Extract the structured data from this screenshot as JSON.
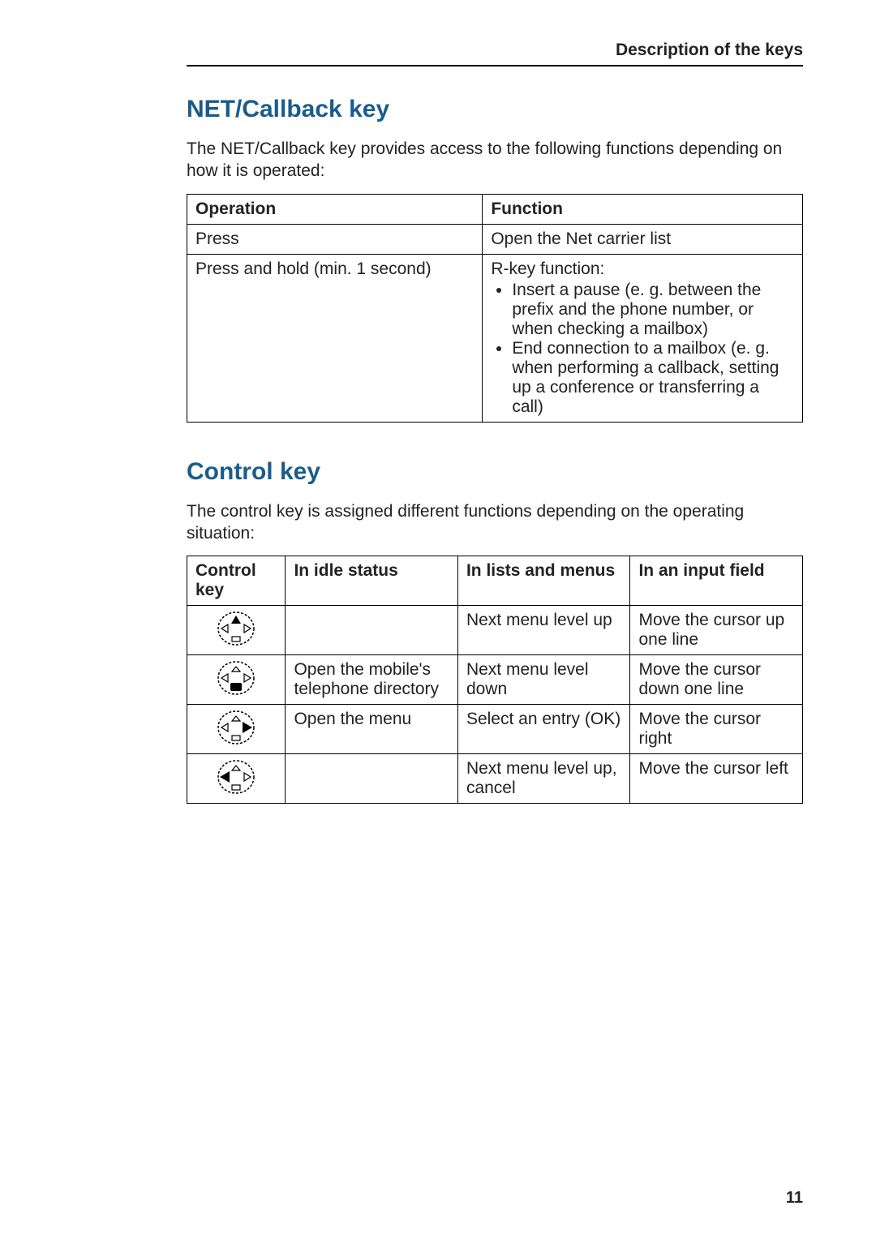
{
  "header": {
    "section": "Description of the keys"
  },
  "sections": {
    "net": {
      "heading": "NET/Callback key",
      "intro": "The NET/Callback key provides access to the following functions depending on how it is operated:",
      "table": {
        "headers": {
          "col1": "Operation",
          "col2": "Function"
        },
        "rows": [
          {
            "operation": "Press",
            "function_text": "Open the Net carrier list"
          },
          {
            "operation": "Press and hold (min. 1 second)",
            "function_text": "R-key function:",
            "bullets": [
              "Insert a pause (e. g. between the prefix and the phone number, or when checking a mailbox)",
              "End connection to a mailbox (e. g. when performing a callback, setting up a conference or transferring a call)"
            ]
          }
        ]
      }
    },
    "control": {
      "heading": "Control key",
      "intro": "The control key is assigned different functions depending on the operating situation:",
      "table": {
        "headers": {
          "col1": "Control key",
          "col2": "In idle status",
          "col3": "In lists and menus",
          "col4": "In an input field"
        },
        "rows": [
          {
            "dir": "up",
            "idle": "",
            "lists": "Next menu level up",
            "input": "Move the cursor up one line"
          },
          {
            "dir": "down",
            "idle": "Open the mobile's telephone directory",
            "lists": "Next menu level down",
            "input": "Move the cursor down one line"
          },
          {
            "dir": "right",
            "idle": "Open the menu",
            "lists": "Select an entry (OK)",
            "input": "Move the cursor right"
          },
          {
            "dir": "left",
            "idle": "",
            "lists": "Next menu level up, cancel",
            "input": "Move the cursor left"
          }
        ]
      }
    }
  },
  "page_number": "11"
}
